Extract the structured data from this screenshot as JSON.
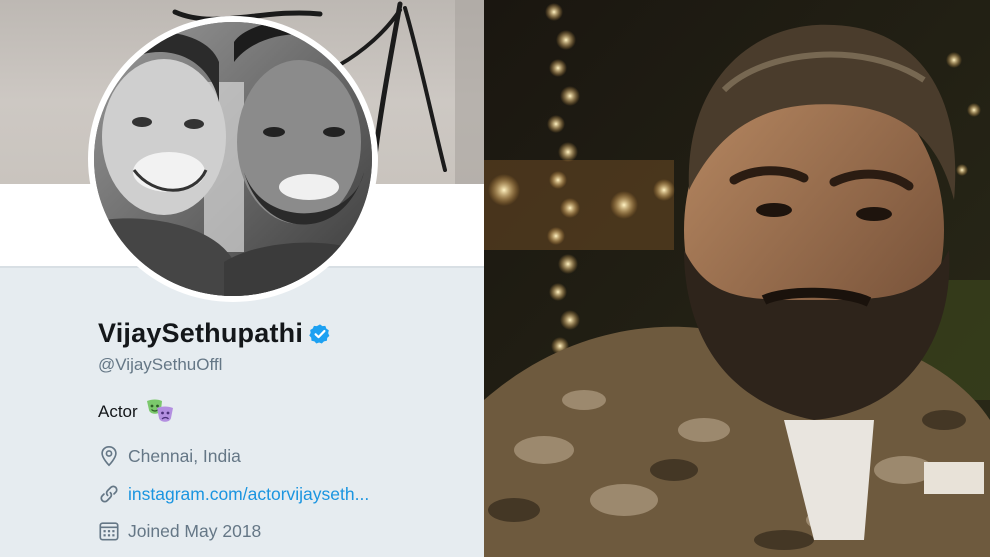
{
  "profile": {
    "display_name": "VijaySethupathi",
    "handle": "@VijaySethuOffl",
    "bio": "Actor",
    "location": "Chennai, India",
    "website": "instagram.com/actorvijayseth...",
    "joined": "Joined May 2018"
  },
  "icons": {
    "verified": "verified-badge-icon",
    "bio_emoji": "performing-arts-masks-icon",
    "location": "location-pin-icon",
    "link": "link-icon",
    "calendar": "calendar-icon"
  },
  "colors": {
    "background": "#e6ecf0",
    "name_text": "#14171a",
    "secondary_text": "#657786",
    "link_text": "#1b95e0",
    "verified_blue": "#1da1f2"
  }
}
